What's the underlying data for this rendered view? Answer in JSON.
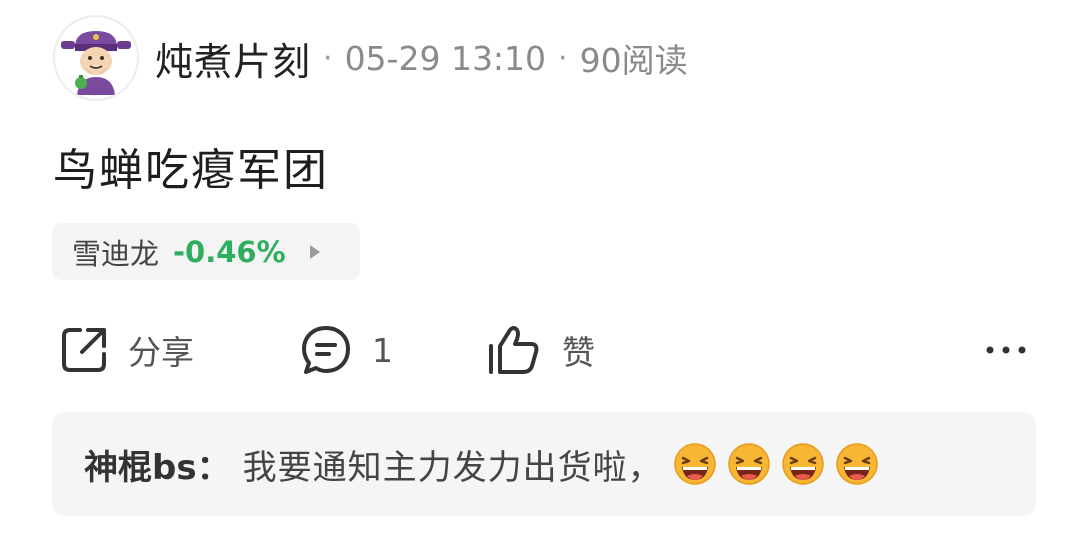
{
  "post": {
    "author": {
      "name": "炖煮片刻",
      "avatar": "cartoon-official-avatar"
    },
    "meta": {
      "separator": "·",
      "datetime": "05-29 13:10",
      "views": "90阅读"
    },
    "text": "鸟蝉吃瘪军团",
    "stock_tag": {
      "name": "雪迪龙",
      "change": "-0.46%",
      "change_color": "#2fae5f",
      "arrow_icon": "triangle-right-icon"
    }
  },
  "actions": {
    "share": {
      "icon": "share-icon",
      "label": "分享"
    },
    "comment": {
      "icon": "comment-icon",
      "count": "1"
    },
    "like": {
      "icon": "thumbs-up-icon",
      "label": "赞"
    },
    "more": {
      "icon": "more-icon"
    }
  },
  "comment_preview": {
    "author": "神棍bs",
    "colon": "：",
    "text": "我要通知主力发力出货啦，",
    "emojis": [
      "laughing-emoji",
      "laughing-emoji",
      "laughing-emoji",
      "laughing-emoji"
    ]
  },
  "colors": {
    "accent_down": "#2fae5f",
    "text_primary": "#222222",
    "text_secondary": "#8a8a8a",
    "background_card": "#f5f5f5"
  }
}
